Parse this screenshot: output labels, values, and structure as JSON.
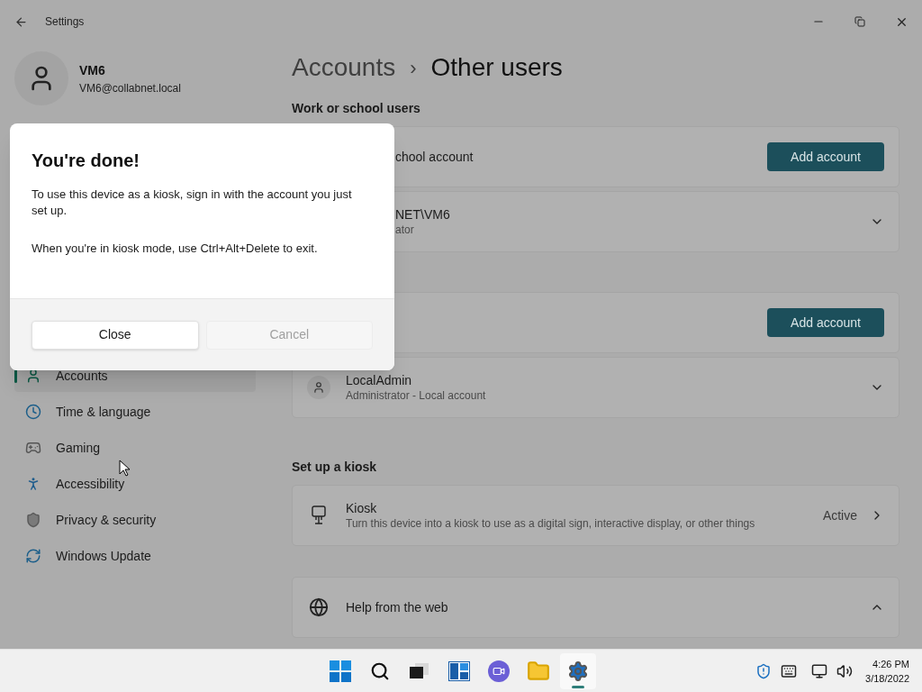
{
  "title_bar": {
    "title": "Settings"
  },
  "user": {
    "name": "VM6",
    "email": "VM6@collabnet.local"
  },
  "sidebar": {
    "items": [
      {
        "label": "Accounts",
        "selected": true
      },
      {
        "label": "Time & language",
        "selected": false
      },
      {
        "label": "Gaming",
        "selected": false
      },
      {
        "label": "Accessibility",
        "selected": false
      },
      {
        "label": "Privacy & security",
        "selected": false
      },
      {
        "label": "Windows Update",
        "selected": false
      }
    ]
  },
  "breadcrumb": {
    "parent": "Accounts",
    "separator": "›",
    "current": "Other users"
  },
  "sections": [
    {
      "heading": "Work or school users",
      "rows": [
        {
          "kind": "action",
          "label": "chool account",
          "button": "Add account"
        },
        {
          "kind": "user",
          "name": "NET\\VM6",
          "subtitle": "ator",
          "expanded": false
        }
      ]
    },
    {
      "rows": [
        {
          "kind": "action",
          "button": "Add account"
        },
        {
          "kind": "user",
          "name": "LocalAdmin",
          "subtitle": "Administrator - Local account",
          "expanded": false
        }
      ]
    },
    {
      "heading": "Set up a kiosk",
      "rows": [
        {
          "kind": "link",
          "name": "Kiosk",
          "subtitle": "Turn this device into a kiosk to use as a digital sign, interactive display, or other things",
          "status": "Active"
        }
      ]
    },
    {
      "rows": [
        {
          "kind": "expander",
          "name": "Help from the web",
          "expanded": true
        }
      ]
    }
  ],
  "dialog": {
    "title": "You're done!",
    "paragraphs": [
      "To use this device as a kiosk, sign in with the account you just set up.",
      "When you're in kiosk mode, use Ctrl+Alt+Delete to exit."
    ],
    "buttons": [
      {
        "label": "Close",
        "disabled": false
      },
      {
        "label": "Cancel",
        "disabled": true
      }
    ]
  },
  "taskbar": {
    "apps": [
      {
        "kind": "start",
        "selected": false
      },
      {
        "kind": "search",
        "selected": false
      },
      {
        "kind": "taskview",
        "selected": false
      },
      {
        "kind": "widgets",
        "selected": false
      },
      {
        "kind": "chat",
        "selected": false
      },
      {
        "kind": "explorer",
        "selected": false
      },
      {
        "kind": "settings",
        "selected": true
      }
    ],
    "time": "4:26 PM",
    "date": "3/18/2022"
  }
}
